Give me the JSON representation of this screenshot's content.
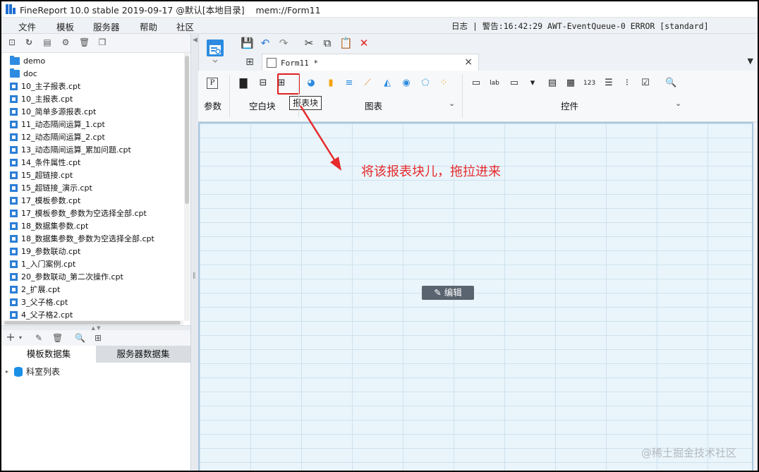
{
  "window": {
    "title": "FineReport 10.0 stable 2019-09-17 @默认[本地目录]    mem://Form11"
  },
  "menu": {
    "items": [
      "文件",
      "模板",
      "服务器",
      "帮助",
      "社区"
    ],
    "log_label": "日志",
    "log_text": "| 警告:16:42:29 AWT-EventQueue-0 ERROR [standard]"
  },
  "tree": {
    "items": [
      {
        "label": "demo",
        "type": "folder"
      },
      {
        "label": "doc",
        "type": "folder"
      },
      {
        "label": "10_主子报表.cpt",
        "type": "cpt"
      },
      {
        "label": "10_主报表.cpt",
        "type": "cpt"
      },
      {
        "label": "10_简单多源报表.cpt",
        "type": "cpt"
      },
      {
        "label": "11_动态隔间运算_1.cpt",
        "type": "cpt"
      },
      {
        "label": "12_动态隔间运算_2.cpt",
        "type": "cpt"
      },
      {
        "label": "13_动态隔间运算_累加问题.cpt",
        "type": "cpt"
      },
      {
        "label": "14_条件属性.cpt",
        "type": "cpt"
      },
      {
        "label": "15_超链接.cpt",
        "type": "cpt"
      },
      {
        "label": "15_超链接_演示.cpt",
        "type": "cpt"
      },
      {
        "label": "17_模板参数.cpt",
        "type": "cpt"
      },
      {
        "label": "17_模板参数_参数为空选择全部.cpt",
        "type": "cpt"
      },
      {
        "label": "18_数据集参数.cpt",
        "type": "cpt"
      },
      {
        "label": "18_数据集参数_参数为空选择全部.cpt",
        "type": "cpt"
      },
      {
        "label": "19_参数联动.cpt",
        "type": "cpt"
      },
      {
        "label": "1_入门案例.cpt",
        "type": "cpt"
      },
      {
        "label": "20_参数联动_第二次操作.cpt",
        "type": "cpt"
      },
      {
        "label": "2_扩展.cpt",
        "type": "cpt"
      },
      {
        "label": "3_父子格.cpt",
        "type": "cpt"
      },
      {
        "label": "4_父子格2.cpt",
        "type": "cpt"
      }
    ]
  },
  "dataset": {
    "tabs": [
      "模板数据集",
      "服务器数据集"
    ],
    "items": [
      "科室列表"
    ]
  },
  "editor": {
    "tab_label": "Form11 *",
    "groups": {
      "param": "参数",
      "blank_block": "空白块",
      "chart": "图表",
      "widget": "控件"
    },
    "tooltip": "报表块",
    "annotation": "将该报表块儿，拖拉进来",
    "edit_button": "编辑"
  },
  "watermark": "@稀土掘金技术社区",
  "colors": {
    "accent": "#1f6fd1",
    "highlight_red": "#e02020",
    "canvas_bg": "#e9f5fb"
  }
}
